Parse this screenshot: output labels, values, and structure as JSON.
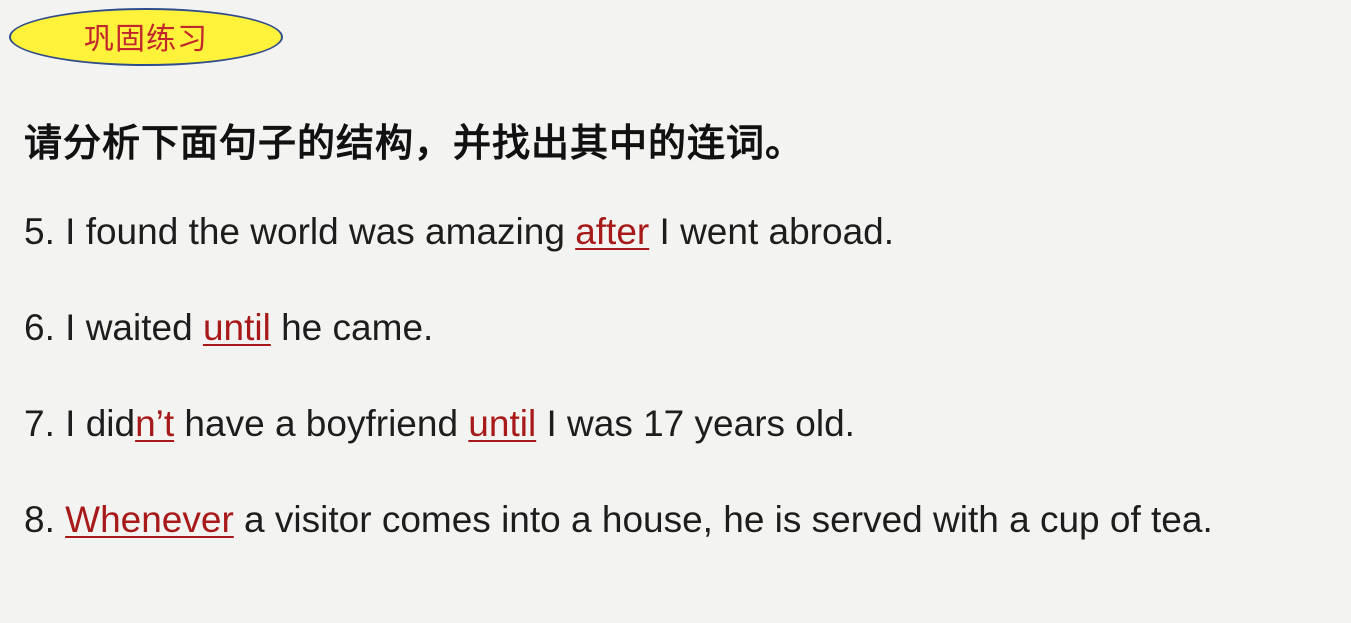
{
  "badge": {
    "label": "巩固练习"
  },
  "instruction": "请分析下面句子的结构，并找出其中的连词。",
  "sentences": [
    {
      "number": "5.",
      "parts": [
        " I found the world was amazing ",
        "after",
        " I went abroad."
      ]
    },
    {
      "number": "6.",
      "parts": [
        " I waited ",
        "until",
        " he came."
      ]
    },
    {
      "number": "7.",
      "parts": [
        " I did",
        "n’t",
        " have a boyfriend ",
        "until",
        " I was 17 years old."
      ]
    },
    {
      "number": "8.",
      "parts": [
        " ",
        "Whenever",
        " a visitor comes into a house, he is served with a cup of tea."
      ]
    }
  ],
  "colors": {
    "highlight": "#a8191a",
    "badge_fill": "#fff23a",
    "badge_border": "#2f4d8c",
    "badge_text": "#c0262b"
  }
}
